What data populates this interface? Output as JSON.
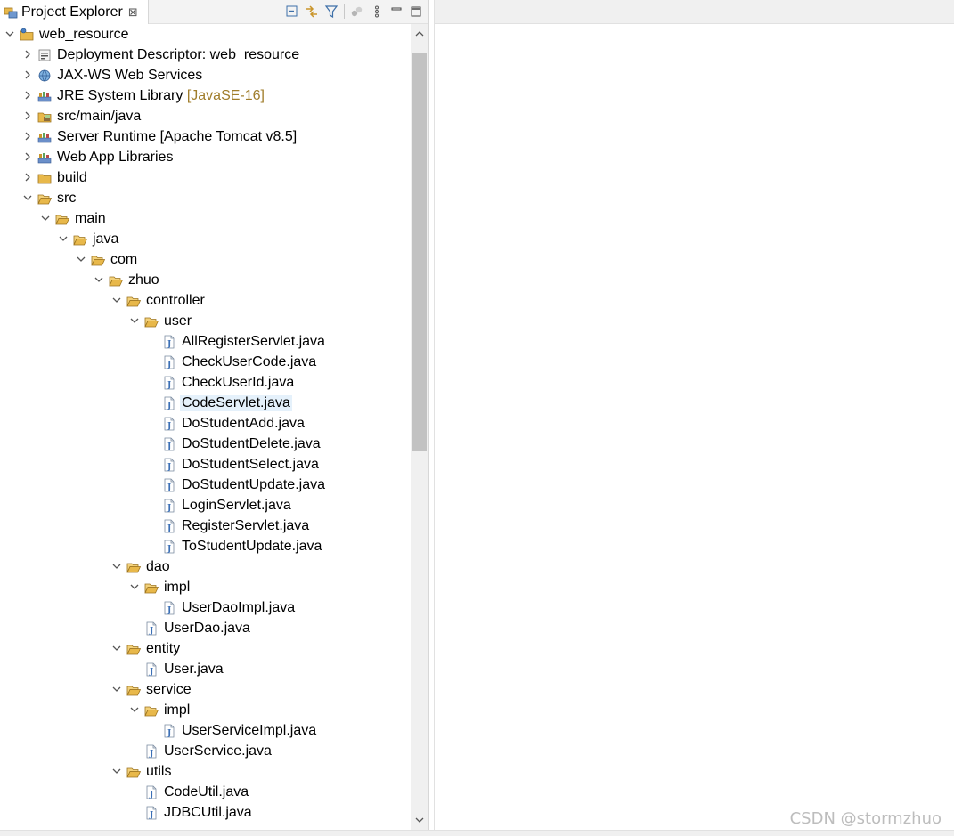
{
  "view": {
    "tab_title": "Project Explorer",
    "close_glyph": "⊠"
  },
  "toolbar": {
    "buttons": [
      "collapse-all-icon",
      "link-with-editor-icon",
      "filter-icon",
      "focus-icon",
      "view-menu-icon",
      "minimize-icon",
      "maximize-icon"
    ]
  },
  "tree": {
    "rows": [
      {
        "label": "web_resource",
        "depth": 0,
        "state": "expanded",
        "icon": "project-icon"
      },
      {
        "label": "Deployment Descriptor: web_resource",
        "depth": 1,
        "state": "collapsed",
        "icon": "deployment-descriptor-icon"
      },
      {
        "label": "JAX-WS Web Services",
        "depth": 1,
        "state": "collapsed",
        "icon": "web-services-icon"
      },
      {
        "label": "JRE System Library",
        "decoration": "[JavaSE-16]",
        "depth": 1,
        "state": "collapsed",
        "icon": "library-icon"
      },
      {
        "label": "src/main/java",
        "depth": 1,
        "state": "collapsed",
        "icon": "source-folder-icon"
      },
      {
        "label": "Server Runtime [Apache Tomcat v8.5]",
        "depth": 1,
        "state": "collapsed",
        "icon": "library-icon"
      },
      {
        "label": "Web App Libraries",
        "depth": 1,
        "state": "collapsed",
        "icon": "library-icon"
      },
      {
        "label": "build",
        "depth": 1,
        "state": "collapsed",
        "icon": "folder-icon"
      },
      {
        "label": "src",
        "depth": 1,
        "state": "expanded",
        "icon": "folder-open-icon"
      },
      {
        "label": "main",
        "depth": 2,
        "state": "expanded",
        "icon": "folder-open-icon"
      },
      {
        "label": "java",
        "depth": 3,
        "state": "expanded",
        "icon": "folder-open-icon"
      },
      {
        "label": "com",
        "depth": 4,
        "state": "expanded",
        "icon": "folder-open-icon"
      },
      {
        "label": "zhuo",
        "depth": 5,
        "state": "expanded",
        "icon": "folder-open-icon"
      },
      {
        "label": "controller",
        "depth": 6,
        "state": "expanded",
        "icon": "folder-open-icon"
      },
      {
        "label": "user",
        "depth": 7,
        "state": "expanded",
        "icon": "folder-open-icon"
      },
      {
        "label": "AllRegisterServlet.java",
        "depth": 8,
        "state": "leaf",
        "icon": "java-file-icon"
      },
      {
        "label": "CheckUserCode.java",
        "depth": 8,
        "state": "leaf",
        "icon": "java-file-icon"
      },
      {
        "label": "CheckUserId.java",
        "depth": 8,
        "state": "leaf",
        "icon": "java-file-icon"
      },
      {
        "label": "CodeServlet.java",
        "depth": 8,
        "state": "leaf",
        "icon": "java-file-icon",
        "selected": true
      },
      {
        "label": "DoStudentAdd.java",
        "depth": 8,
        "state": "leaf",
        "icon": "java-file-icon"
      },
      {
        "label": "DoStudentDelete.java",
        "depth": 8,
        "state": "leaf",
        "icon": "java-file-icon"
      },
      {
        "label": "DoStudentSelect.java",
        "depth": 8,
        "state": "leaf",
        "icon": "java-file-icon"
      },
      {
        "label": "DoStudentUpdate.java",
        "depth": 8,
        "state": "leaf",
        "icon": "java-file-icon"
      },
      {
        "label": "LoginServlet.java",
        "depth": 8,
        "state": "leaf",
        "icon": "java-file-icon"
      },
      {
        "label": "RegisterServlet.java",
        "depth": 8,
        "state": "leaf",
        "icon": "java-file-icon"
      },
      {
        "label": "ToStudentUpdate.java",
        "depth": 8,
        "state": "leaf",
        "icon": "java-file-icon"
      },
      {
        "label": "dao",
        "depth": 6,
        "state": "expanded",
        "icon": "folder-open-icon"
      },
      {
        "label": "impl",
        "depth": 7,
        "state": "expanded",
        "icon": "folder-open-icon"
      },
      {
        "label": "UserDaoImpl.java",
        "depth": 8,
        "state": "leaf",
        "icon": "java-file-icon"
      },
      {
        "label": "UserDao.java",
        "depth": 7,
        "state": "leaf",
        "icon": "java-file-icon"
      },
      {
        "label": "entity",
        "depth": 6,
        "state": "expanded",
        "icon": "folder-open-icon"
      },
      {
        "label": "User.java",
        "depth": 7,
        "state": "leaf",
        "icon": "java-file-icon"
      },
      {
        "label": "service",
        "depth": 6,
        "state": "expanded",
        "icon": "folder-open-icon"
      },
      {
        "label": "impl",
        "depth": 7,
        "state": "expanded",
        "icon": "folder-open-icon"
      },
      {
        "label": "UserServiceImpl.java",
        "depth": 8,
        "state": "leaf",
        "icon": "java-file-icon"
      },
      {
        "label": "UserService.java",
        "depth": 7,
        "state": "leaf",
        "icon": "java-file-icon"
      },
      {
        "label": "utils",
        "depth": 6,
        "state": "expanded",
        "icon": "folder-open-icon"
      },
      {
        "label": "CodeUtil.java",
        "depth": 7,
        "state": "leaf",
        "icon": "java-file-icon"
      },
      {
        "label": "JDBCUtil.java",
        "depth": 7,
        "state": "leaf",
        "icon": "java-file-icon"
      }
    ]
  },
  "watermark": "CSDN @stormzhuo",
  "colors": {
    "selection": "#e5f1fb",
    "decoration": "#a07d2b",
    "folder": "#e8b84a",
    "java_file": "#3b6fb6"
  }
}
